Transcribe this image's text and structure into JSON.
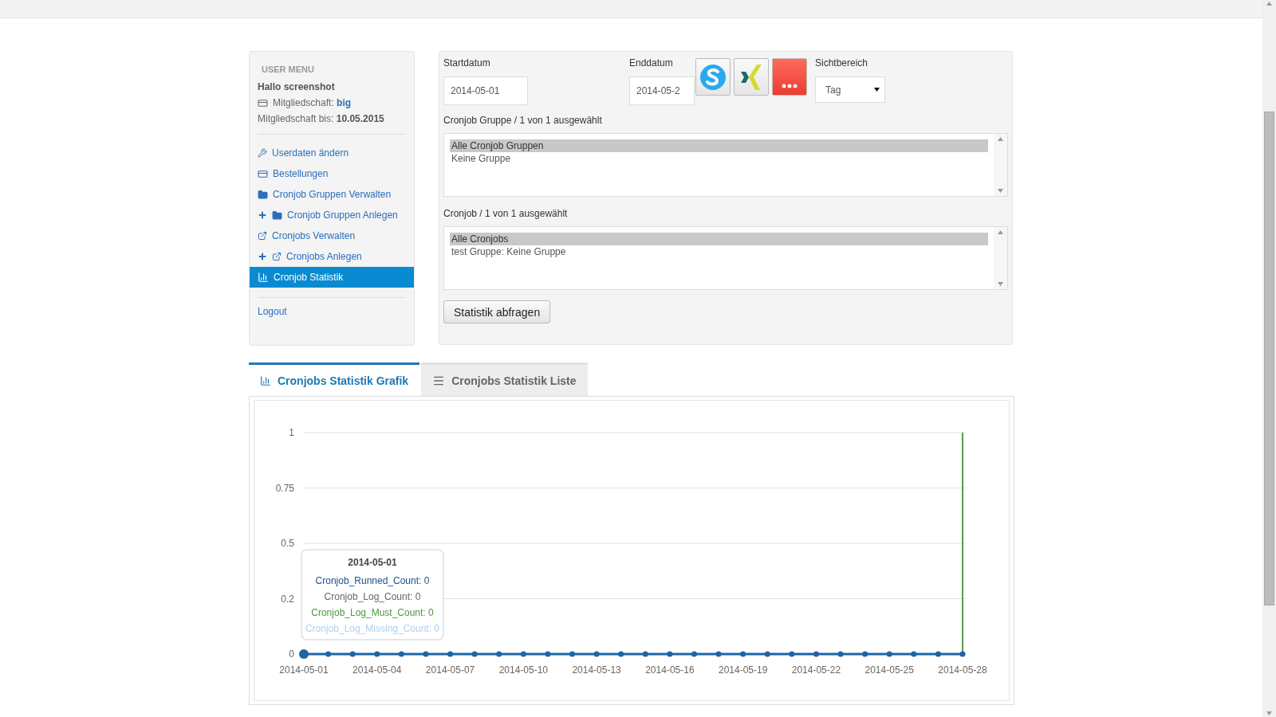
{
  "sidebar": {
    "heading": "USER MENU",
    "greeting": "Hallo screenshot",
    "membership_label": "Mitgliedschaft: ",
    "membership_value": "big",
    "until_label": "Mitgliedschaft bis: ",
    "until_value": "10.05.2015",
    "items": [
      {
        "label": "Userdaten ändern",
        "kind": "wrench",
        "plus": false,
        "selected": false
      },
      {
        "label": "Bestellungen",
        "kind": "card",
        "plus": false,
        "selected": false
      },
      {
        "label": "Cronjob Gruppen Verwalten",
        "kind": "folder",
        "plus": false,
        "selected": false
      },
      {
        "label": "Cronjob Gruppen Anlegen",
        "kind": "folder",
        "plus": true,
        "selected": false
      },
      {
        "label": "Cronjobs Verwalten",
        "kind": "external",
        "plus": false,
        "selected": false
      },
      {
        "label": "Cronjobs Anlegen",
        "kind": "external",
        "plus": true,
        "selected": false
      },
      {
        "label": "Cronjob Statistik",
        "kind": "chart",
        "plus": false,
        "selected": true
      }
    ],
    "logout": "Logout"
  },
  "form": {
    "start_label": "Startdatum",
    "start_value": "2014-05-01",
    "end_label": "Enddatum",
    "end_value": "2014-05-2",
    "range_label": "Sichtbereich",
    "range_value": "Tag",
    "lists": [
      {
        "label": "Cronjob Gruppe / 1 von 1 ausgewählt",
        "options": [
          {
            "text": "Alle Cronjob Gruppen",
            "selected": true
          },
          {
            "text": "Keine Gruppe",
            "selected": false
          }
        ]
      },
      {
        "label": "Cronjob / 1 von 1 ausgewählt",
        "options": [
          {
            "text": "Alle Cronjobs",
            "selected": true
          },
          {
            "text": "test Gruppe: Keine Gruppe",
            "selected": false
          }
        ]
      }
    ],
    "submit": "Statistik abfragen"
  },
  "share_buttons": [
    {
      "kind": "skype"
    },
    {
      "kind": "xing"
    },
    {
      "kind": "more"
    }
  ],
  "tabs": [
    {
      "label": "Cronjobs Statistik Grafik",
      "kind": "chart",
      "selected": true
    },
    {
      "label": "Cronjobs Statistik Liste",
      "kind": "list",
      "selected": false
    }
  ],
  "chart": {
    "chart_data": {
      "type": "line",
      "x": [
        "2014-05-01",
        "2014-05-02",
        "2014-05-03",
        "2014-05-04",
        "2014-05-05",
        "2014-05-06",
        "2014-05-07",
        "2014-05-08",
        "2014-05-09",
        "2014-05-10",
        "2014-05-11",
        "2014-05-12",
        "2014-05-13",
        "2014-05-14",
        "2014-05-15",
        "2014-05-16",
        "2014-05-17",
        "2014-05-18",
        "2014-05-19",
        "2014-05-20",
        "2014-05-21",
        "2014-05-22",
        "2014-05-23",
        "2014-05-24",
        "2014-05-25",
        "2014-05-26",
        "2014-05-27",
        "2014-05-28"
      ],
      "xticks": [
        "2014-05-01",
        "2014-05-04",
        "2014-05-07",
        "2014-05-10",
        "2014-05-13",
        "2014-05-16",
        "2014-05-19",
        "2014-05-22",
        "2014-05-25",
        "2014-05-28"
      ],
      "xlim": [
        "2014-05-01",
        "2014-05-28"
      ],
      "ylim": [
        0,
        1
      ],
      "yticks": [
        0,
        {
          "value": 0.25,
          "label": "0.2"
        },
        0.5,
        0.75,
        1
      ],
      "grid": true,
      "ref_lines": [
        {
          "axis": "x",
          "value": "2014-05-28",
          "color": "#5b9a55"
        }
      ],
      "series": [
        {
          "color": "#1f64a5",
          "marker": true,
          "values": [
            0,
            0,
            0,
            0,
            0,
            0,
            0,
            0,
            0,
            0,
            0,
            0,
            0,
            0,
            0,
            0,
            0,
            0,
            0,
            0,
            0,
            0,
            0,
            0,
            0,
            0,
            0,
            0
          ]
        }
      ]
    },
    "tooltip": {
      "title": "2014-05-01",
      "lines": [
        {
          "text": "Cronjob_Runned_Count: 0",
          "color": "#1f4e8c"
        },
        {
          "text": "Cronjob_Log_Count: 0",
          "color": "#666666"
        },
        {
          "text": "Cronjob_Log_Must_Count: 0",
          "color": "#4a9a3c"
        },
        {
          "text": "Cronjob_Log_Missing_Count: 0",
          "color": "#a9d0f2"
        }
      ]
    }
  }
}
